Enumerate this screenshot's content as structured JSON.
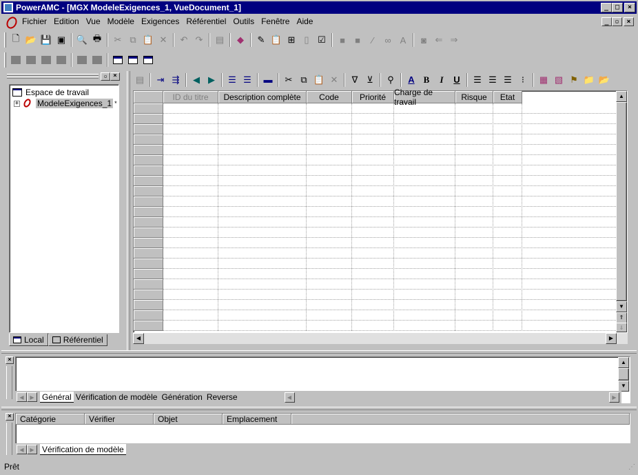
{
  "window": {
    "title": "PowerAMC - [MGX ModeleExigences_1, VueDocument_1]"
  },
  "menu": {
    "items": [
      "Fichier",
      "Edition",
      "Vue",
      "Modèle",
      "Exigences",
      "Référentiel",
      "Outils",
      "Fenêtre",
      "Aide"
    ]
  },
  "browser": {
    "root_label": "Espace de travail",
    "model_label": "ModeleExigences_1",
    "model_marker": "*",
    "tab_local": "Local",
    "tab_repository": "Référentiel"
  },
  "document": {
    "columns": [
      "ID du titre",
      "Description complète",
      "Code",
      "Priorité",
      "Charge de travail",
      "Risque",
      "Etat"
    ],
    "rows": []
  },
  "output": {
    "tabs": [
      "Général",
      "Vérification de modèle",
      "Génération",
      "Reverse"
    ],
    "active_tab": "Général"
  },
  "result_list": {
    "columns": [
      "Catégorie",
      "Vérifier",
      "Objet",
      "Emplacement"
    ],
    "tabs": [
      "Vérification de modèle"
    ]
  },
  "status": {
    "text": "Prêt"
  },
  "icons": {
    "toolbar1": [
      "new-icon",
      "open-icon",
      "save-icon",
      "save-all-icon",
      "print-preview-icon",
      "print-icon",
      "cut-icon",
      "copy-icon",
      "paste-icon",
      "delete-icon",
      "undo-icon",
      "redo-icon",
      "properties-icon",
      "book-icon",
      "edit-icon",
      "paste-special-icon",
      "find-icon",
      "blank-icon",
      "check-icon",
      "generic-icon",
      "generic-icon",
      "pencil-icon",
      "link-icon",
      "font-icon",
      "camera-icon",
      "back-icon",
      "forward-icon"
    ]
  },
  "colors": {
    "titlebar": "#000080",
    "chrome": "#c0c0c0"
  }
}
